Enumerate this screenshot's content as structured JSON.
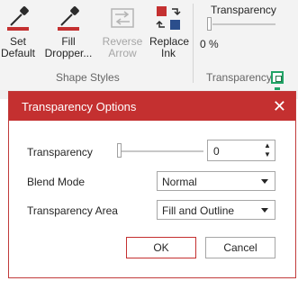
{
  "ribbon": {
    "buttons": [
      {
        "label_line1": "Set",
        "label_line2": "Default",
        "icon": "set-default-dropper-icon"
      },
      {
        "label_line1": "Fill",
        "label_line2": "Dropper...",
        "icon": "fill-dropper-icon"
      },
      {
        "label_line1": "Reverse",
        "label_line2": "Arrow",
        "icon": "reverse-arrow-icon",
        "disabled": true
      },
      {
        "label_line1": "Replace",
        "label_line2": "Ink",
        "icon": "replace-ink-icon"
      }
    ],
    "group_shape_styles": "Shape Styles",
    "transparency_title": "Transparency",
    "transparency_value": "0 %",
    "transparency_level": 0,
    "group_transparency": "Transparency"
  },
  "dialog": {
    "title": "Transparency Options",
    "close_glyph": "✕",
    "transparency_label": "Transparency",
    "transparency_value": "0",
    "blend_mode_label": "Blend Mode",
    "blend_mode_value": "Normal",
    "area_label": "Transparency Area",
    "area_value": "Fill and Outline",
    "ok_label": "OK",
    "cancel_label": "Cancel"
  },
  "colors": {
    "accent": "#c43030",
    "launcher_green": "#21a366"
  }
}
